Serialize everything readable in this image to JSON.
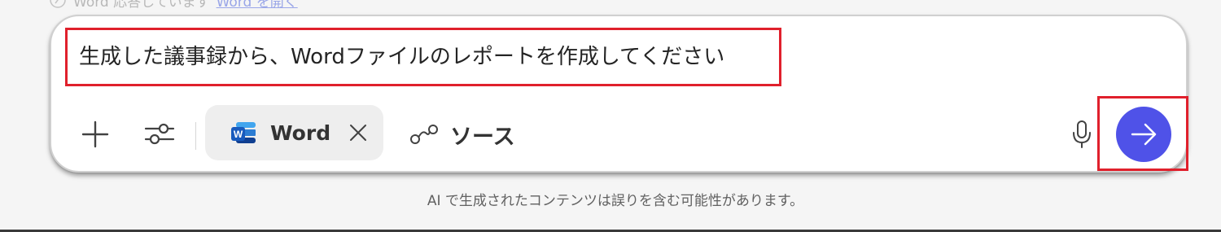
{
  "status": {
    "text": "Word 応答しています",
    "link": "Word を開く",
    "icon": "sparkle-icon"
  },
  "composer": {
    "prompt": "生成した議事録から、Wordファイルのレポートを作成してください",
    "toolbar": {
      "add_icon": "plus-icon",
      "settings_icon": "sliders-icon",
      "chip": {
        "label": "Word",
        "icon": "word-icon",
        "close_icon": "close-icon"
      },
      "source": {
        "label": "ソース",
        "icon": "link-nodes-icon"
      },
      "mic_icon": "microphone-icon",
      "send_icon": "arrow-right-icon"
    }
  },
  "disclaimer": "AI で生成されたコンテンツは誤りを含む可能性があります。",
  "colors": {
    "accent": "#4f52e8",
    "highlight": "#e0202c",
    "word_blue": "#185abd"
  }
}
